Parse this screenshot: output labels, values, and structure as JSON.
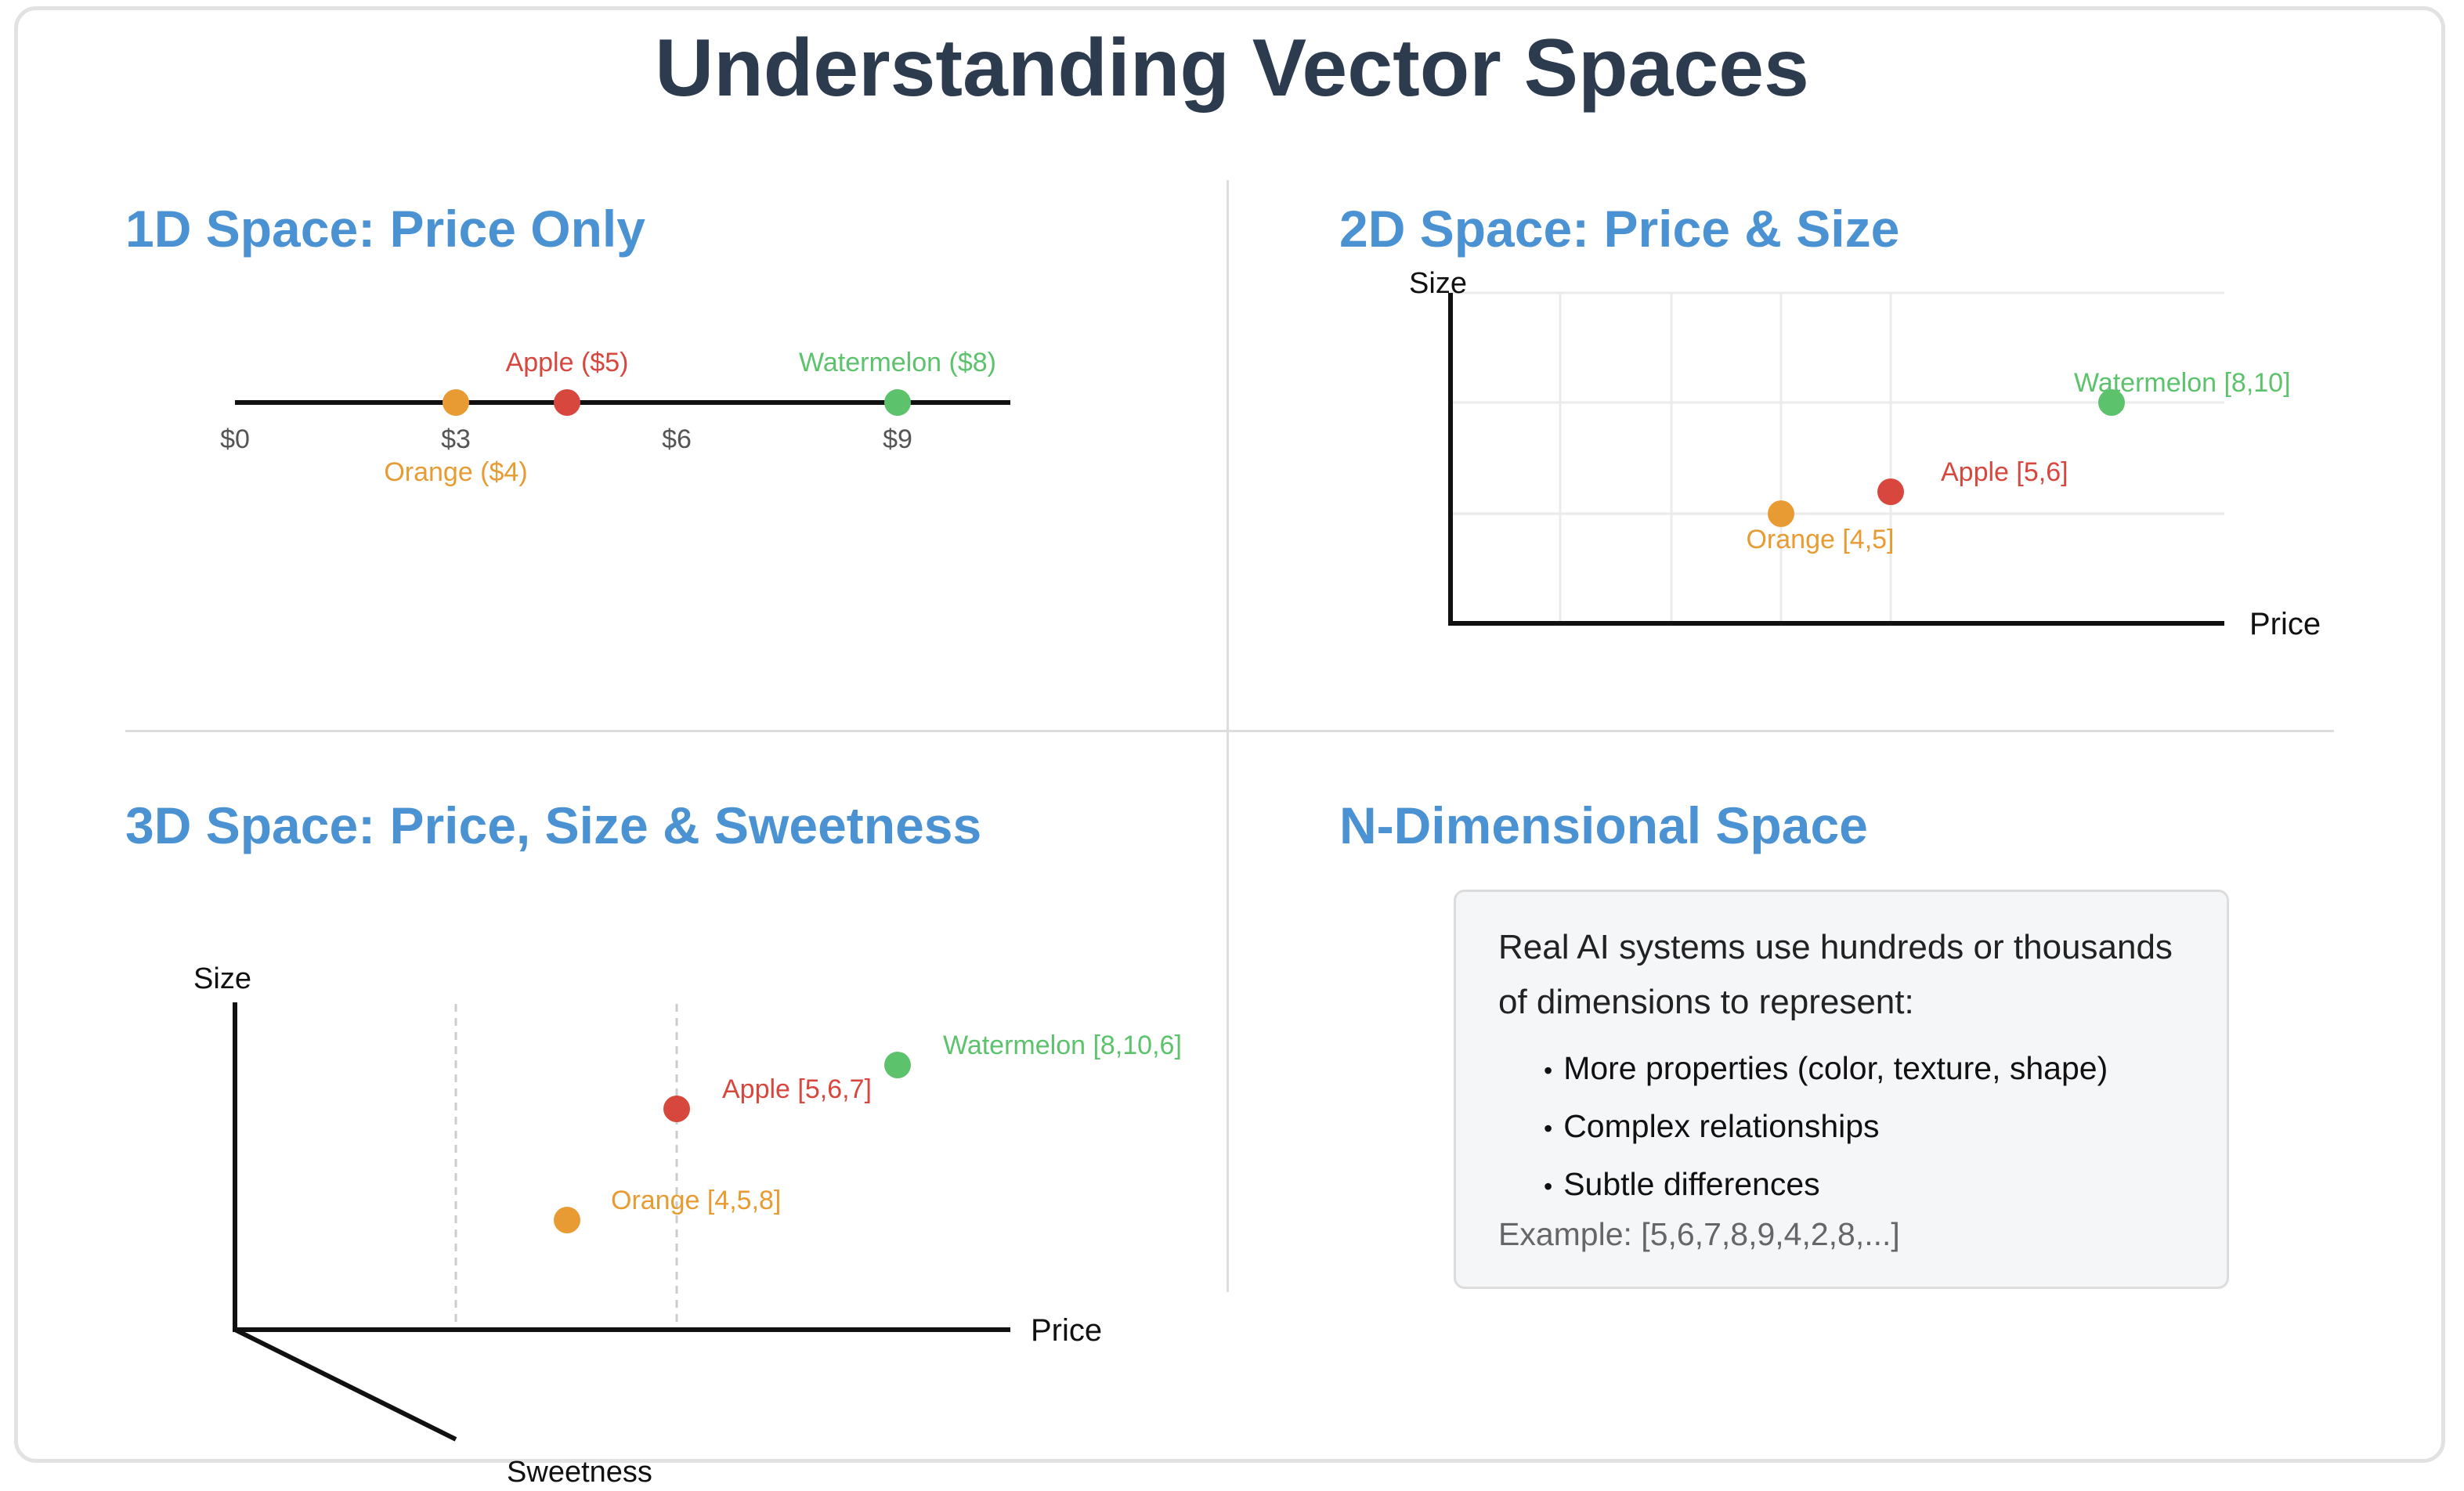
{
  "title": "Understanding Vector Spaces",
  "colors": {
    "apple": "#d8473e",
    "orange": "#e89b32",
    "watermelon": "#5cc26c",
    "heading": "#4b92d3",
    "title": "#2d3b4e"
  },
  "panels": {
    "one_d": {
      "title": "1D Space: Price Only",
      "ticks": [
        "$0",
        "$3",
        "$6",
        "$9"
      ],
      "points": [
        {
          "name": "Orange",
          "label": "Orange ($4)",
          "price": 3
        },
        {
          "name": "Apple",
          "label": "Apple ($5)",
          "price": 4.5
        },
        {
          "name": "Watermelon",
          "label": "Watermelon ($8)",
          "price": 9
        }
      ]
    },
    "two_d": {
      "title": "2D Space: Price & Size",
      "x_label": "Price",
      "y_label": "Size",
      "points": [
        {
          "name": "Orange",
          "label": "Orange [4,5]",
          "price": 4,
          "size": 5
        },
        {
          "name": "Apple",
          "label": "Apple [5,6]",
          "price": 5,
          "size": 6
        },
        {
          "name": "Watermelon",
          "label": "Watermelon [8,10]",
          "price": 8,
          "size": 10
        }
      ]
    },
    "three_d": {
      "title": "3D Space: Price, Size & Sweetness",
      "x_label": "Price",
      "y_label": "Size",
      "z_label": "Sweetness",
      "points": [
        {
          "name": "Orange",
          "label": "Orange [4,5,8]",
          "price": 4,
          "size": 5,
          "sweetness": 8
        },
        {
          "name": "Apple",
          "label": "Apple [5,6,7]",
          "price": 5,
          "size": 6,
          "sweetness": 7
        },
        {
          "name": "Watermelon",
          "label": "Watermelon [8,10,6]",
          "price": 8,
          "size": 10,
          "sweetness": 6
        }
      ]
    },
    "n_d": {
      "title": "N-Dimensional Space",
      "intro": "Real AI systems use hundreds or thousands of dimensions to represent:",
      "items": [
        "More properties (color, texture, shape)",
        "Complex relationships",
        "Subtle differences"
      ],
      "example": "Example: [5,6,7,8,9,4,2,8,...]"
    }
  }
}
